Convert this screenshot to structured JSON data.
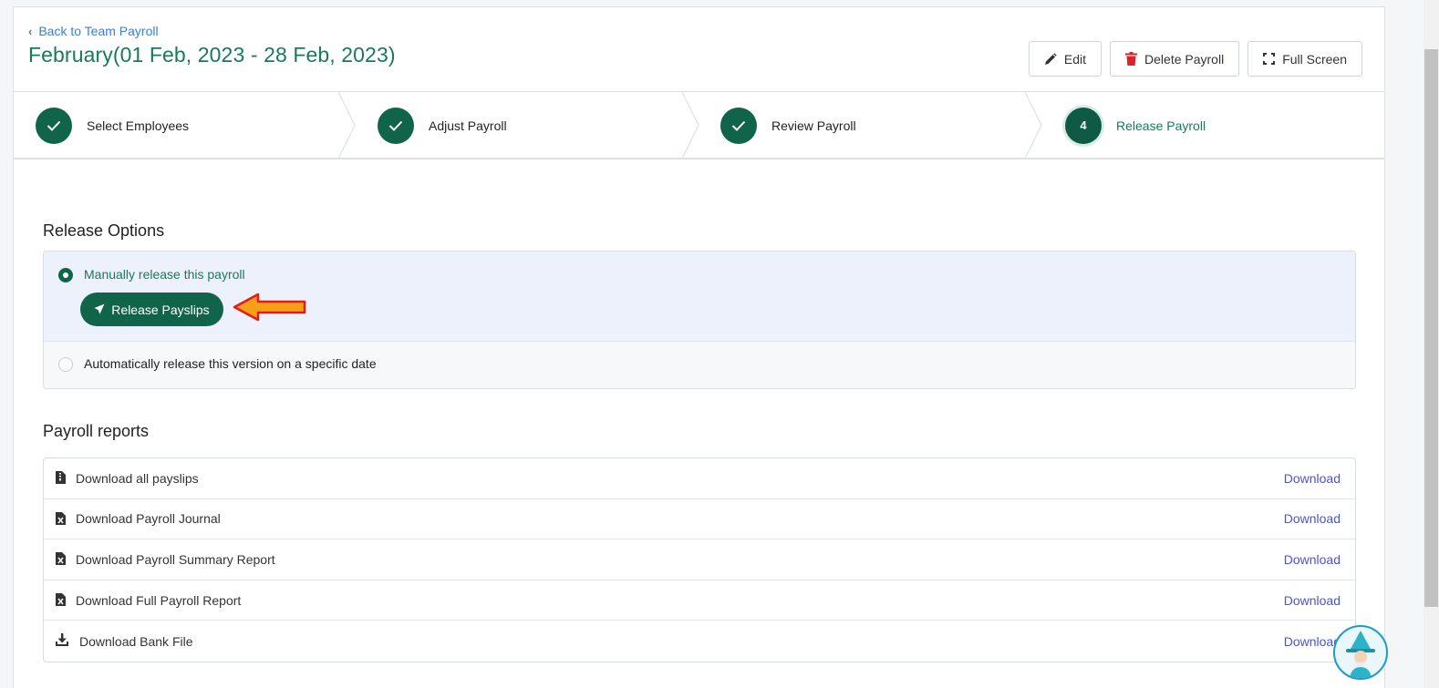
{
  "header": {
    "back_label": "Back to Team Payroll",
    "title": "February(01 Feb, 2023 - 28 Feb, 2023)",
    "edit_label": "Edit",
    "delete_label": "Delete Payroll",
    "fullscreen_label": "Full Screen"
  },
  "stepper": {
    "steps": [
      {
        "label": "Select Employees",
        "state": "completed"
      },
      {
        "label": "Adjust Payroll",
        "state": "completed"
      },
      {
        "label": "Review Payroll",
        "state": "completed"
      },
      {
        "label": "Release Payroll",
        "state": "active",
        "number": "4"
      }
    ]
  },
  "release_options": {
    "title": "Release Options",
    "manual_label": "Manually release this payroll",
    "manual_selected": true,
    "release_button_label": "Release Payslips",
    "auto_label": "Automatically release this version on a specific date",
    "auto_selected": false
  },
  "reports": {
    "title": "Payroll reports",
    "rows": [
      {
        "label": "Download all payslips",
        "action": "Download",
        "icon": "file-zip-icon"
      },
      {
        "label": "Download Payroll Journal",
        "action": "Download",
        "icon": "file-excel-icon"
      },
      {
        "label": "Download Payroll Summary Report",
        "action": "Download",
        "icon": "file-excel-icon"
      },
      {
        "label": "Download Full Payroll Report",
        "action": "Download",
        "icon": "file-excel-icon"
      },
      {
        "label": "Download Bank File",
        "action": "Download",
        "icon": "download-icon"
      }
    ]
  },
  "colors": {
    "brand_green": "#10644a",
    "title_green": "#187a5c",
    "link_blue": "#3b7fd1",
    "download_link": "#4b53d6",
    "delete_red": "#d6262c",
    "annotation_arrow": "#e21b1b"
  }
}
